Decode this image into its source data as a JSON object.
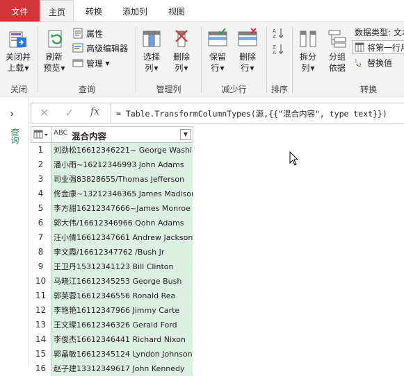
{
  "tabs": [
    {
      "label": "文件",
      "kind": "file"
    },
    {
      "label": "主页",
      "kind": "active"
    },
    {
      "label": "转换",
      "kind": "normal"
    },
    {
      "label": "添加列",
      "kind": "normal"
    },
    {
      "label": "视图",
      "kind": "normal"
    }
  ],
  "ribbon": {
    "close": {
      "line1": "关闭并",
      "line2": "上载"
    },
    "refresh": {
      "line1": "刷新",
      "line2": "预览"
    },
    "properties": "属性",
    "advanced_editor": "高级编辑器",
    "manage": "管理",
    "choose_cols": {
      "line1": "选择",
      "line2": "列"
    },
    "remove_cols": {
      "line1": "删除",
      "line2": "列"
    },
    "keep_rows": {
      "line1": "保留",
      "line2": "行"
    },
    "remove_rows": {
      "line1": "删除",
      "line2": "行"
    },
    "split_col": {
      "line1": "拆分",
      "line2": "列"
    },
    "group_by": {
      "line1": "分组",
      "line2": "依据"
    },
    "data_type": "数据类型: 文本",
    "first_row_header": "将第一行用",
    "replace_values": "替换值",
    "groups": {
      "close": "关闭",
      "query": "查询",
      "manage_cols": "管理列",
      "reduce_rows": "减少行",
      "sort": "排序",
      "transform": "转换"
    }
  },
  "left_pane": {
    "label": "查询"
  },
  "formula_bar": {
    "formula": "= Table.TransformColumnTypes(源,{{\"混合内容\", type text}})"
  },
  "table": {
    "column_type": "ABC",
    "column_name": "混合内容",
    "rows": [
      {
        "index": "1",
        "value": "刘劲松16612346221~ George Washin..."
      },
      {
        "index": "2",
        "value": "潘小雨~16212346993 John Adams"
      },
      {
        "index": "3",
        "value": "司业强83828655/Thomas Jefferson"
      },
      {
        "index": "4",
        "value": "佟金康~13212346365 James Madison"
      },
      {
        "index": "5",
        "value": "李方甜16212347666~James Monroe"
      },
      {
        "index": "6",
        "value": "郭大伟/16612346966  Qohn Adams"
      },
      {
        "index": "7",
        "value": "汪小倩16612347661 Andrew Jackson"
      },
      {
        "index": "8",
        "value": "李文霞/16612347762 /Bush Jr"
      },
      {
        "index": "9",
        "value": "王卫丹15312341123 Bill Clinton"
      },
      {
        "index": "10",
        "value": "马晓江16612345253 George Bush"
      },
      {
        "index": "11",
        "value": "郭芙蓉16612346556 Ronald Rea"
      },
      {
        "index": "12",
        "value": "李艳艳16112347966 Jimmy Carte"
      },
      {
        "index": "13",
        "value": "王文璨16612346326 Gerald Ford"
      },
      {
        "index": "14",
        "value": "李俊杰16612346441 Richard Nixon"
      },
      {
        "index": "15",
        "value": "郭晶敏16612345124 Lyndon Johnson"
      },
      {
        "index": "16",
        "value": "赵子建13312349617 John Kennedy"
      }
    ]
  }
}
